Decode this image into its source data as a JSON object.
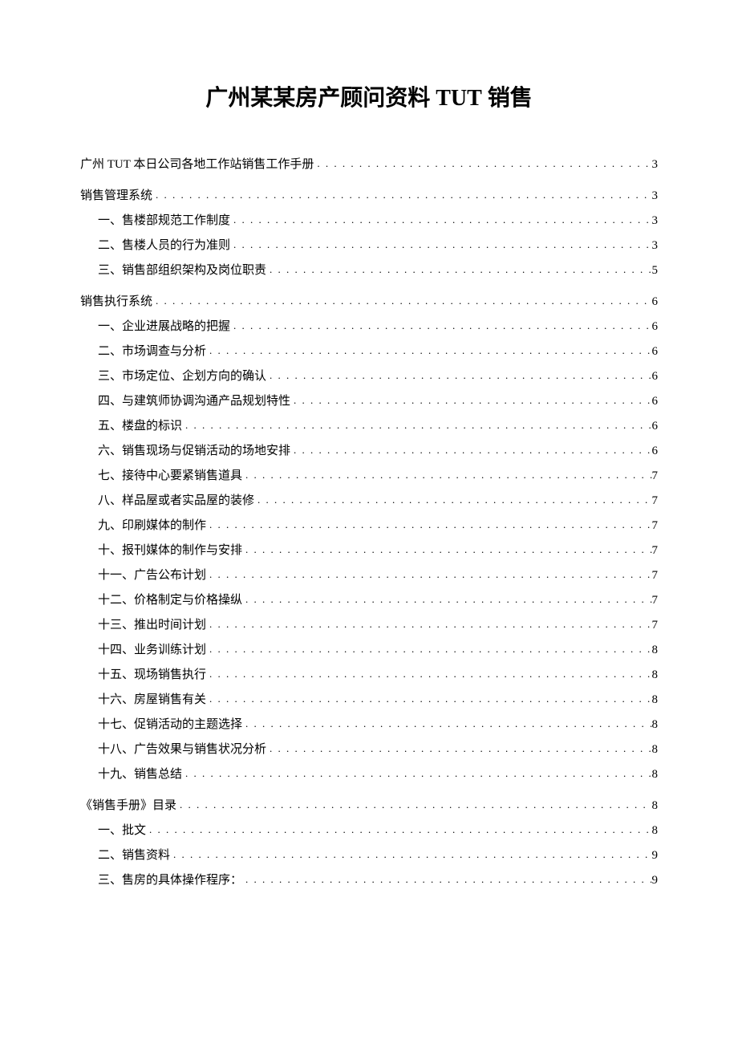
{
  "title_cn_prefix": "广州某某房产顾问资料 ",
  "title_latin": "TUT",
  "title_cn_suffix": " 销售",
  "toc": [
    {
      "label": "广州 TUT 本日公司各地工作站销售工作手册",
      "page": "3",
      "level": 0,
      "first": true
    },
    {
      "label": "销售管理系统",
      "page": "3",
      "level": 0
    },
    {
      "label": "一、售楼部规范工作制度",
      "page": "3",
      "level": 1
    },
    {
      "label": "二、售楼人员的行为准则",
      "page": "3",
      "level": 1
    },
    {
      "label": "三、销售部组织架构及岗位职责",
      "page": "5",
      "level": 1
    },
    {
      "label": "销售执行系统",
      "page": "6",
      "level": 0
    },
    {
      "label": "一、企业进展战略的把握",
      "page": "6",
      "level": 1
    },
    {
      "label": "二、市场调查与分析",
      "page": "6",
      "level": 1
    },
    {
      "label": "三、市场定位、企划方向的确认",
      "page": "6",
      "level": 1
    },
    {
      "label": "四、与建筑师协调沟通产品规划特性",
      "page": "6",
      "level": 1
    },
    {
      "label": "五、楼盘的标识",
      "page": "6",
      "level": 1
    },
    {
      "label": "六、销售现场与促销活动的场地安排",
      "page": "6",
      "level": 1
    },
    {
      "label": "七、接待中心要紧销售道具",
      "page": "7",
      "level": 1
    },
    {
      "label": "八、样品屋或者实品屋的装修",
      "page": "7",
      "level": 1
    },
    {
      "label": "九、印刷媒体的制作",
      "page": "7",
      "level": 1
    },
    {
      "label": "十、报刊媒体的制作与安排",
      "page": "7",
      "level": 1
    },
    {
      "label": "十一、广告公布计划",
      "page": "7",
      "level": 1
    },
    {
      "label": "十二、价格制定与价格操纵",
      "page": "7",
      "level": 1
    },
    {
      "label": "十三、推出时间计划",
      "page": "7",
      "level": 1
    },
    {
      "label": "十四、业务训练计划",
      "page": "8",
      "level": 1
    },
    {
      "label": "十五、现场销售执行",
      "page": "8",
      "level": 1
    },
    {
      "label": "十六、房屋销售有关",
      "page": "8",
      "level": 1
    },
    {
      "label": "十七、促销活动的主题选择",
      "page": "8",
      "level": 1
    },
    {
      "label": "十八、广告效果与销售状况分析",
      "page": "8",
      "level": 1
    },
    {
      "label": "十九、销售总结",
      "page": "8",
      "level": 1
    },
    {
      "label": "《销售手册》目录",
      "page": "8",
      "level": 0
    },
    {
      "label": "一、批文",
      "page": "8",
      "level": 1
    },
    {
      "label": "二、销售资料",
      "page": "9",
      "level": 1
    },
    {
      "label": "三、售房的具体操作程序：",
      "page": "9",
      "level": 1
    }
  ]
}
